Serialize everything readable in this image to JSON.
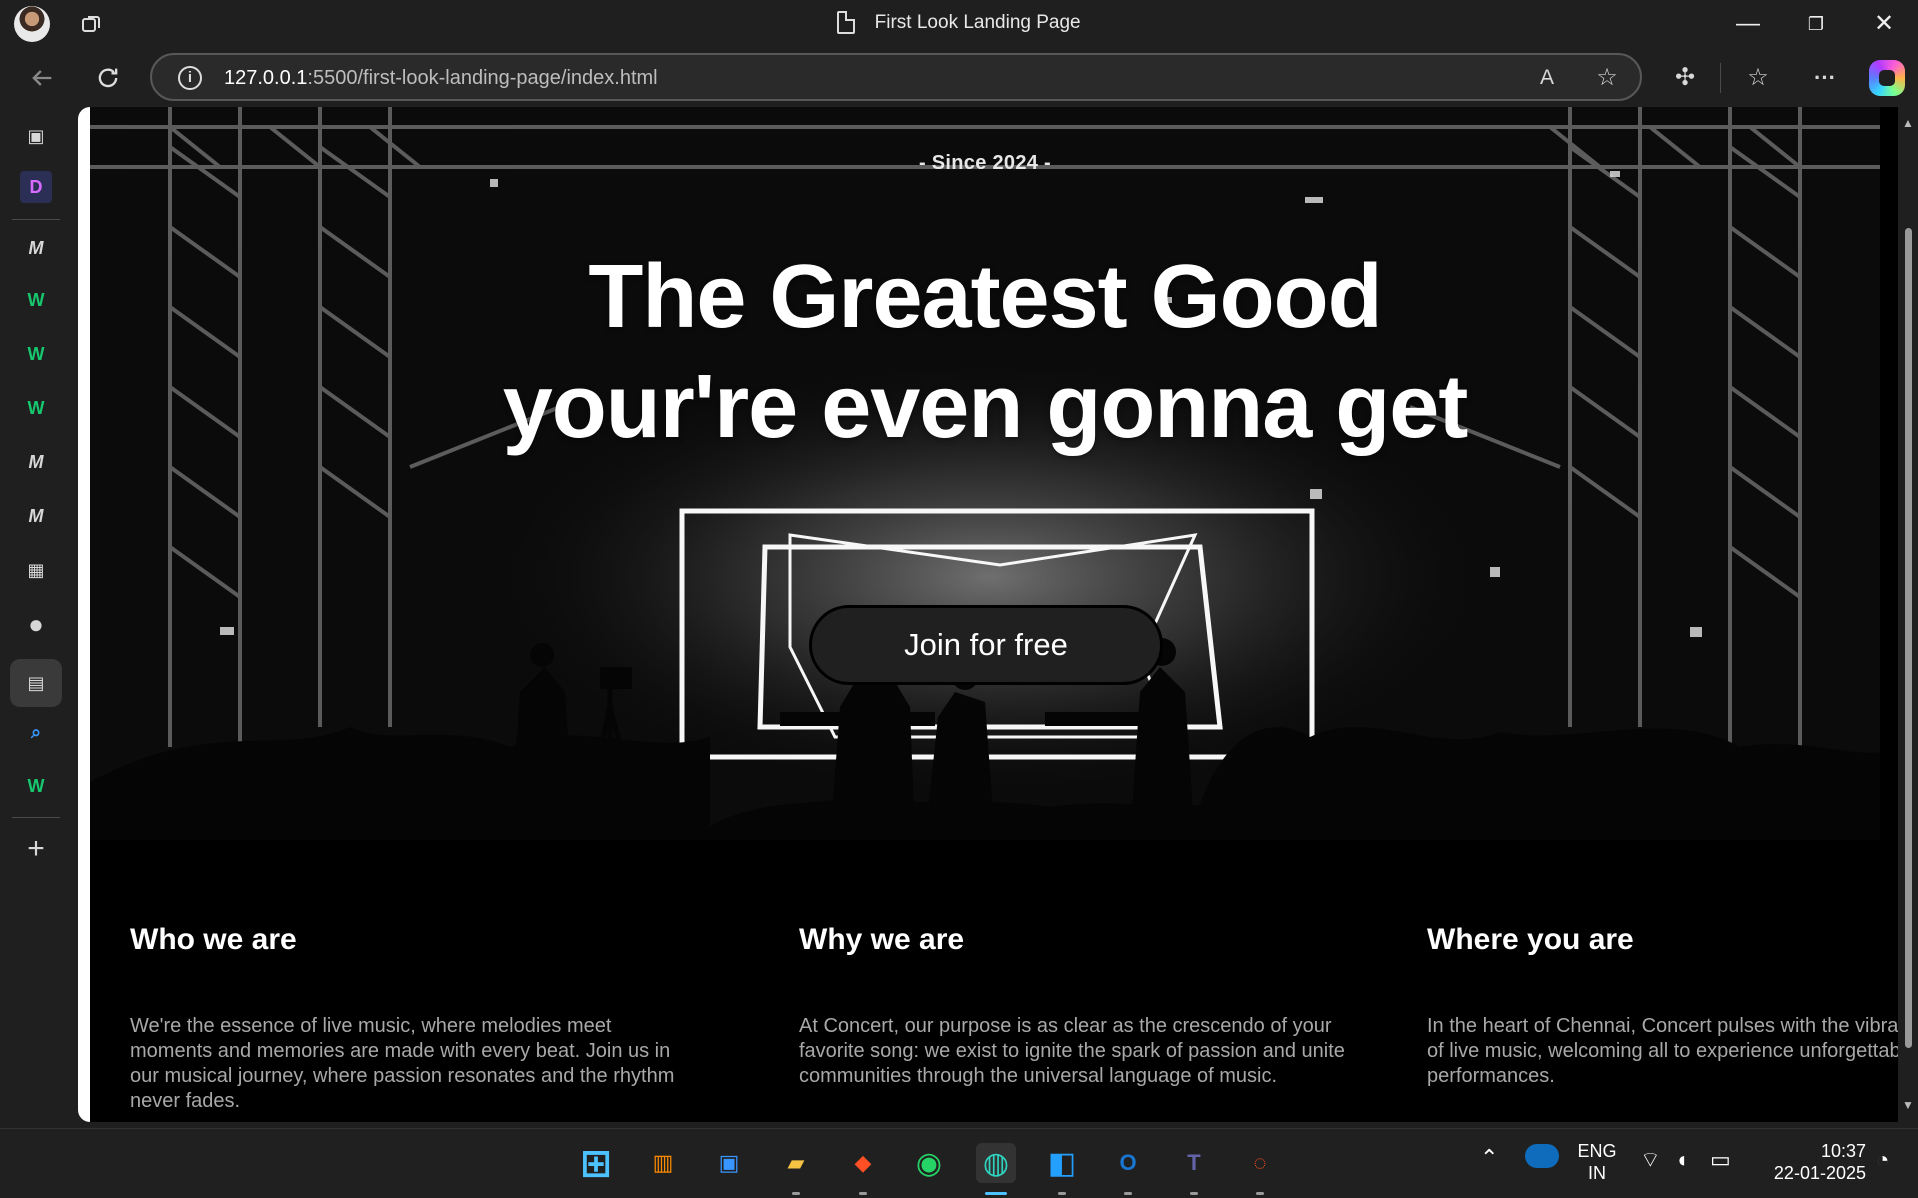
{
  "window": {
    "title": "First Look Landing Page",
    "minimize": "—",
    "restore": "❐",
    "close": "✕"
  },
  "toolbar": {
    "back_icon": "arrow-left-icon",
    "reload_icon": "refresh-icon",
    "url_host": "127.0.0.1",
    "url_rest": ":5500/first-look-landing-page/index.html",
    "read_aloud": "A",
    "favorite_icon": "star-icon",
    "extensions_icon": "puzzle-icon",
    "favorites_icon": "favorites-icon",
    "more": "···"
  },
  "sidebar": {
    "items": [
      {
        "name": "tab-actions-icon",
        "label": "▣"
      },
      {
        "name": "sidebar-item-d",
        "label": "D"
      },
      {
        "name": "sidebar-item-m1",
        "label": "M"
      },
      {
        "name": "sidebar-item-w1",
        "label": "W"
      },
      {
        "name": "sidebar-item-w2",
        "label": "W"
      },
      {
        "name": "sidebar-item-w3",
        "label": "W"
      },
      {
        "name": "sidebar-item-m2",
        "label": "M"
      },
      {
        "name": "sidebar-item-m3",
        "label": "M"
      },
      {
        "name": "sidebar-item-calendar",
        "label": "▦"
      },
      {
        "name": "sidebar-item-github",
        "label": "●"
      },
      {
        "name": "sidebar-item-page",
        "label": "▤"
      },
      {
        "name": "sidebar-item-search",
        "label": "⌕"
      },
      {
        "name": "sidebar-item-w4",
        "label": "W"
      }
    ],
    "add": "+"
  },
  "hero": {
    "since": "- Since 2024 -",
    "headline_line1": "The Greatest Good",
    "headline_line2": "your're even gonna get",
    "cta": "Join for free"
  },
  "sections": [
    {
      "title": "Who we are",
      "body": "We're the essence of live music, where melodies meet moments and memories are made with every beat. Join us in our musical journey, where passion resonates and the rhythm never fades."
    },
    {
      "title": "Why we are",
      "body": "At Concert, our purpose is as clear as the crescendo of your favorite song: we exist to ignite the spark of passion and unite communities through the universal language of music."
    },
    {
      "title": "Where you are",
      "body": "In the heart of Chennai, Concert pulses with the vibrant energy of live music, welcoming all to experience unforgettable performances."
    }
  ],
  "taskbar": {
    "apps": [
      {
        "name": "start-icon",
        "label": "⊞",
        "color": "#4cc2ff"
      },
      {
        "name": "store-icon",
        "label": "▥",
        "color": "#ff8c00"
      },
      {
        "name": "widgets-icon",
        "label": "▣",
        "color": "#3a96ff"
      },
      {
        "name": "file-explorer-icon",
        "label": "▰",
        "color": "#f6c244"
      },
      {
        "name": "brave-icon",
        "label": "◆",
        "color": "#ff4f24"
      },
      {
        "name": "whatsapp-icon",
        "label": "◉",
        "color": "#25d366"
      },
      {
        "name": "edge-icon",
        "label": "◍",
        "color": "#2dd4bf"
      },
      {
        "name": "vscode-icon",
        "label": "◧",
        "color": "#229fff"
      },
      {
        "name": "outlook-icon",
        "label": "O",
        "color": "#1877d2"
      },
      {
        "name": "teams-icon",
        "label": "T",
        "color": "#6264a7"
      },
      {
        "name": "figma-icon",
        "label": "◌",
        "color": "#f24e1e"
      }
    ],
    "tray_caret": "⌃",
    "cloud_icon": "onedrive-icon",
    "lang_top": "ENG",
    "lang_bottom": "IN",
    "wifi": "⌔",
    "volume": "◖",
    "battery": "▭",
    "time": "10:37",
    "date": "22-01-2025",
    "notifications": "◔"
  }
}
